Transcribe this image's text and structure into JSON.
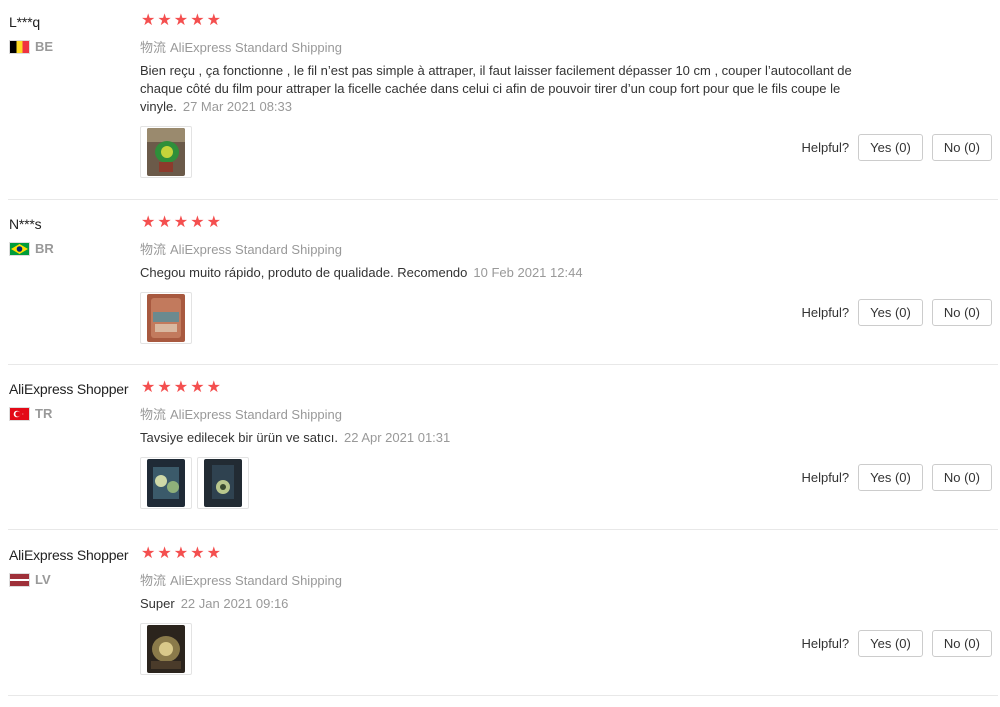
{
  "reviews": [
    {
      "user": "L***q",
      "country": "BE",
      "flag_colors": [
        "#000000",
        "#fdda24",
        "#ef3340"
      ],
      "rating": 5,
      "shipping_key": "物流",
      "shipping_method": "AliExpress Standard Shipping",
      "text": "Bien reçu , ça fonctionne , le fil n’est pas simple à attraper, il faut laisser facilement dépasser 10 cm , couper l’autocollant de chaque côté du film pour attraper la ficelle cachée dans celui ci afin de pouvoir tirer d’un coup fort pour que le fils coupe le vinyle.",
      "date": "27 Mar 2021 08:33",
      "photos": [
        "photo-icon"
      ],
      "helpful_label": "Helpful?",
      "yes_label": "Yes (0)",
      "no_label": "No (0)"
    },
    {
      "user": "N***s",
      "country": "BR",
      "flag_colors": [
        "#009c3b",
        "#ffdf00",
        "#002776"
      ],
      "rating": 5,
      "shipping_key": "物流",
      "shipping_method": "AliExpress Standard Shipping",
      "text": "Chegou muito rápido, produto de qualidade. Recomendo",
      "date": "10 Feb 2021 12:44",
      "photos": [
        "photo-icon"
      ],
      "helpful_label": "Helpful?",
      "yes_label": "Yes (0)",
      "no_label": "No (0)"
    },
    {
      "user": "AliExpress Shopper",
      "country": "TR",
      "flag_colors": [
        "#e30a17",
        "#ffffff"
      ],
      "rating": 5,
      "shipping_key": "物流",
      "shipping_method": "AliExpress Standard Shipping",
      "text": "Tavsiye edilecek bir ürün ve satıcı.",
      "date": "22 Apr 2021 01:31",
      "photos": [
        "photo-icon",
        "photo-icon"
      ],
      "helpful_label": "Helpful?",
      "yes_label": "Yes (0)",
      "no_label": "No (0)"
    },
    {
      "user": "AliExpress Shopper",
      "country": "LV",
      "flag_colors": [
        "#9e3039",
        "#ffffff"
      ],
      "rating": 5,
      "shipping_key": "物流",
      "shipping_method": "AliExpress Standard Shipping",
      "text": "Super",
      "date": "22 Jan 2021 09:16",
      "photos": [
        "photo-icon"
      ],
      "helpful_label": "Helpful?",
      "yes_label": "Yes (0)",
      "no_label": "No (0)"
    }
  ]
}
